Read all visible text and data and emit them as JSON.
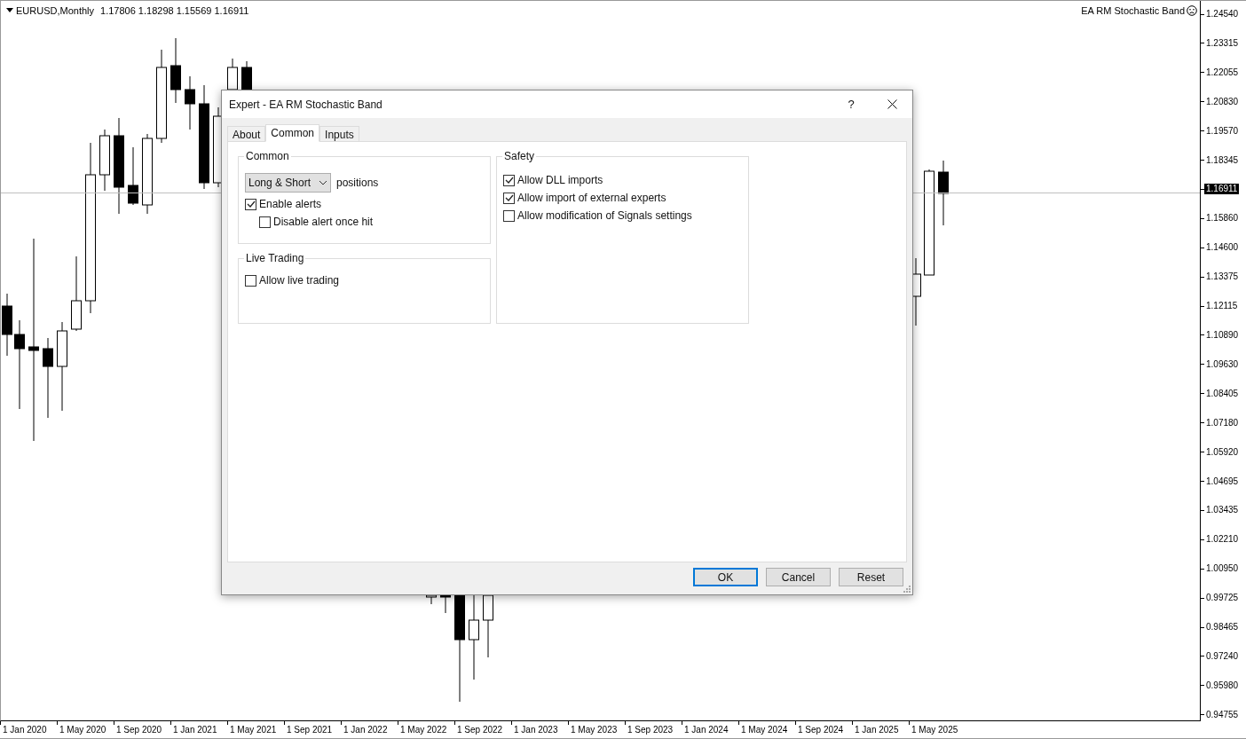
{
  "chart": {
    "symbol": "EURUSD,Monthly",
    "ohlc": "1.17806 1.18298 1.15569 1.16911",
    "expert_name": "EA RM Stochastic Band",
    "price_axis": [
      {
        "kind": "tick",
        "label": "1.24540"
      },
      {
        "kind": "tick",
        "label": "1.23315"
      },
      {
        "kind": "tick",
        "label": "1.22055"
      },
      {
        "kind": "tick",
        "label": "1.20830"
      },
      {
        "kind": "tick",
        "label": "1.19570"
      },
      {
        "kind": "tick",
        "label": "1.18345"
      },
      {
        "kind": "current",
        "label": "1.16911"
      },
      {
        "kind": "tick",
        "label": "1.15860"
      },
      {
        "kind": "tick",
        "label": "1.14600"
      },
      {
        "kind": "tick",
        "label": "1.13375"
      },
      {
        "kind": "tick",
        "label": "1.12115"
      },
      {
        "kind": "tick",
        "label": "1.10890"
      },
      {
        "kind": "tick",
        "label": "1.09630"
      },
      {
        "kind": "tick",
        "label": "1.08405"
      },
      {
        "kind": "tick",
        "label": "1.07180"
      },
      {
        "kind": "tick",
        "label": "1.05920"
      },
      {
        "kind": "tick",
        "label": "1.04695"
      },
      {
        "kind": "tick",
        "label": "1.03435"
      },
      {
        "kind": "tick",
        "label": "1.02210"
      },
      {
        "kind": "tick",
        "label": "1.00950"
      },
      {
        "kind": "tick",
        "label": "0.99725"
      },
      {
        "kind": "tick",
        "label": "0.98465"
      },
      {
        "kind": "tick",
        "label": "0.97240"
      },
      {
        "kind": "tick",
        "label": "0.95980"
      },
      {
        "kind": "tick",
        "label": "0.94755"
      }
    ],
    "time_axis": [
      "1 Jan 2020",
      "1 May 2020",
      "1 Sep 2020",
      "1 Jan 2021",
      "1 May 2021",
      "1 Sep 2021",
      "1 Jan 2022",
      "1 May 2022",
      "1 Sep 2022",
      "1 Jan 2023",
      "1 May 2023",
      "1 Sep 2023",
      "1 Jan 2024",
      "1 May 2024",
      "1 Sep 2024",
      "1 Jan 2025",
      "1 May 2025"
    ]
  },
  "dialog": {
    "title": "Expert - EA RM Stochastic Band",
    "help": "?",
    "tabs": [
      {
        "label": "About",
        "selected": false
      },
      {
        "label": "Common",
        "selected": true
      },
      {
        "label": "Inputs",
        "selected": false
      }
    ],
    "common": {
      "title": "Common",
      "positions_select": "Long & Short",
      "positions_label": "positions",
      "options": [
        {
          "label": "Enable alerts",
          "checked": true,
          "children": [
            {
              "label": "Disable alert once hit",
              "checked": false
            }
          ]
        }
      ]
    },
    "live_trading": {
      "title": "Live Trading",
      "options": [
        {
          "label": "Allow live trading",
          "checked": false
        }
      ]
    },
    "safety": {
      "title": "Safety",
      "options": [
        {
          "label": "Allow DLL imports",
          "checked": true
        },
        {
          "label": "Allow import of external experts",
          "checked": true
        },
        {
          "label": "Allow modification of Signals settings",
          "checked": false
        }
      ]
    },
    "buttons": [
      {
        "label": "OK",
        "selected": true
      },
      {
        "label": "Cancel",
        "selected": false
      },
      {
        "label": "Reset",
        "selected": false
      }
    ]
  }
}
